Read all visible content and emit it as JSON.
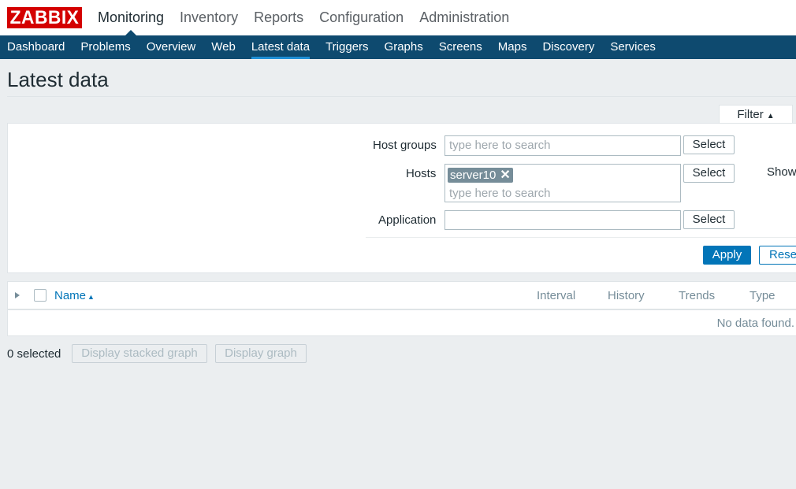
{
  "logo": "ZABBIX",
  "top_nav": [
    {
      "label": "Monitoring",
      "active": true
    },
    {
      "label": "Inventory"
    },
    {
      "label": "Reports"
    },
    {
      "label": "Configuration"
    },
    {
      "label": "Administration"
    }
  ],
  "sub_nav": [
    {
      "label": "Dashboard"
    },
    {
      "label": "Problems"
    },
    {
      "label": "Overview"
    },
    {
      "label": "Web"
    },
    {
      "label": "Latest data",
      "active": true
    },
    {
      "label": "Triggers"
    },
    {
      "label": "Graphs"
    },
    {
      "label": "Screens"
    },
    {
      "label": "Maps"
    },
    {
      "label": "Discovery"
    },
    {
      "label": "Services"
    }
  ],
  "page_title": "Latest data",
  "filter": {
    "tab_label": "Filter",
    "tab_icon": "triangle-up-icon",
    "host_groups_label": "Host groups",
    "host_groups_placeholder": "type here to search",
    "hosts_label": "Hosts",
    "hosts_selected": "server10",
    "hosts_placeholder": "type here to search",
    "application_label": "Application",
    "application_value": "",
    "select_label": "Select",
    "show_label": "Show",
    "apply_label": "Apply",
    "reset_label": "Reset"
  },
  "table": {
    "columns": [
      "Name",
      "Interval",
      "History",
      "Trends",
      "Type"
    ],
    "sort_column": "Name",
    "sort_direction": "asc",
    "empty_text": "No data found."
  },
  "footer": {
    "selected_text": "0 selected",
    "stacked_graph_label": "Display stacked graph",
    "graph_label": "Display graph"
  },
  "colors": {
    "logo_red": "#d40000",
    "subnav_blue": "#0e4a6f",
    "accent_blue": "#0275b8",
    "background": "#ebeef0"
  }
}
